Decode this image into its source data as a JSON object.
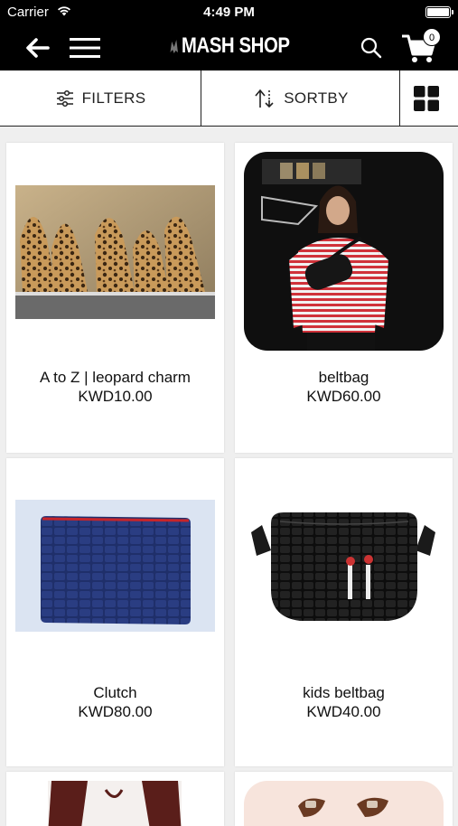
{
  "status": {
    "carrier": "Carrier",
    "time": "4:49 PM"
  },
  "nav": {
    "brand": "MASH SHOP",
    "cart_count": "0"
  },
  "toolbar": {
    "filters_label": "FILTERS",
    "sort_label": "SORTBY"
  },
  "products": [
    {
      "name": "A to Z | leopard charm",
      "price": "KWD10.00"
    },
    {
      "name": "beltbag",
      "price": "KWD60.00"
    },
    {
      "name": "Clutch",
      "price": "KWD80.00"
    },
    {
      "name": "kids beltbag",
      "price": "KWD40.00"
    }
  ],
  "icons": [
    "wifi-icon",
    "battery-icon",
    "back-arrow-icon",
    "hamburger-menu-icon",
    "search-icon",
    "cart-icon",
    "filter-sliders-icon",
    "sort-arrows-icon",
    "grid-view-icon"
  ],
  "colors": {
    "header_bg": "#000000",
    "page_bg": "#efefef",
    "card_bg": "#ffffff"
  }
}
